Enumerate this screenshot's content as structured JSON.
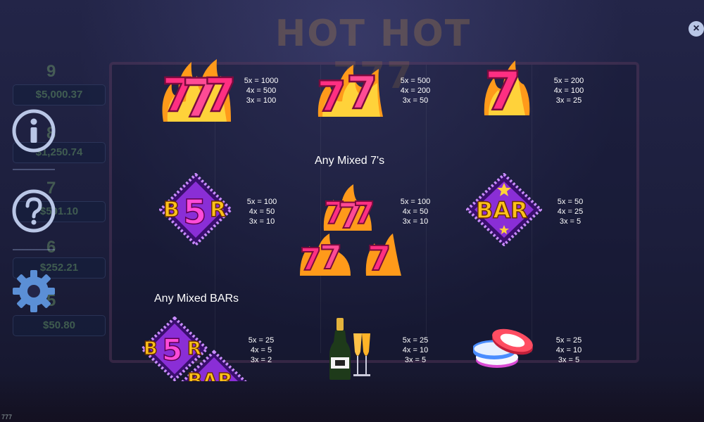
{
  "background": {
    "title": "HOT HOT 777",
    "jackpots": [
      {
        "rank": "9",
        "amount": "$5,000.37"
      },
      {
        "rank": "8",
        "amount": "$1,250.74"
      },
      {
        "rank": "7",
        "amount": "$501.10"
      },
      {
        "rank": "6",
        "amount": "$252.21"
      },
      {
        "rank": "5",
        "amount": "$50.80"
      }
    ]
  },
  "controls": {
    "info_icon": "info-icon",
    "help_icon": "help-icon",
    "settings_icon": "gear-icon",
    "close_icon": "close-icon",
    "close_label": "×"
  },
  "paytable": {
    "rows": [
      {
        "symbols": [
          {
            "name": "triple-seven-symbol",
            "pays": [
              "5x = 1000",
              "4x = 500",
              "3x = 100"
            ]
          },
          {
            "name": "double-seven-symbol",
            "pays": [
              "5x = 500",
              "4x = 200",
              "3x = 50"
            ]
          },
          {
            "name": "single-seven-symbol",
            "pays": [
              "5x = 200",
              "4x = 100",
              "3x = 25"
            ]
          }
        ]
      },
      {
        "symbols": [
          {
            "name": "b5r-bar-symbol",
            "pays": [
              "5x = 100",
              "4x = 50",
              "3x = 10"
            ]
          },
          {
            "name": "mixed-sevens-symbol",
            "pays": [
              "5x = 100",
              "4x = 50",
              "3x = 10"
            ]
          },
          {
            "name": "bar-symbol",
            "pays": [
              "5x = 50",
              "4x = 25",
              "3x = 5"
            ]
          }
        ]
      },
      {
        "symbols": [
          {
            "name": "mixed-bars-symbol",
            "pays": [
              "5x = 25",
              "4x = 5",
              "3x = 2"
            ]
          },
          {
            "name": "champagne-symbol",
            "pays": [
              "5x = 25",
              "4x = 10",
              "3x = 5"
            ]
          },
          {
            "name": "chips-symbol",
            "pays": [
              "5x = 25",
              "4x = 10",
              "3x = 5"
            ]
          }
        ]
      }
    ],
    "labels": {
      "mixed_sevens": "Any Mixed 7's",
      "mixed_bars": "Any Mixed BARs"
    },
    "symbol_text": {
      "seven": "7",
      "bar": "BAR",
      "b5r_b": "B",
      "b5r_5": "5",
      "b5r_r": "R"
    }
  },
  "footer": {
    "corner_text": "777"
  },
  "colors": {
    "seven_fill": "#ff3d8a",
    "flame": "#ffb020",
    "bar_purple": "#7a2ad0",
    "bar_gold": "#ffc21a",
    "icon_blue": "#b9c6e6"
  }
}
